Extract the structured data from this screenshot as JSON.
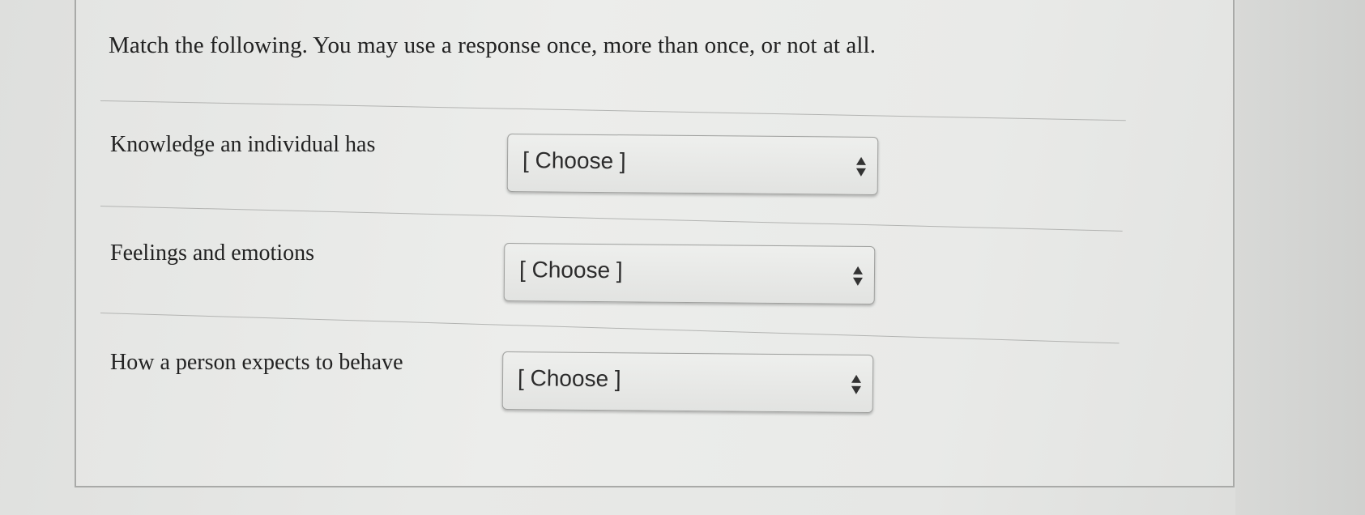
{
  "question": {
    "prompt": "Match the following. You may use a response once, more than once, or not at all."
  },
  "rows": [
    {
      "label": "Knowledge an individual has",
      "selected": "[ Choose ]"
    },
    {
      "label": "Feelings and emotions",
      "selected": "[ Choose ]"
    },
    {
      "label": "How a person expects to behave",
      "selected": "[ Choose ]"
    }
  ],
  "icons": {
    "dropdown": "up-down-arrows-icon"
  }
}
